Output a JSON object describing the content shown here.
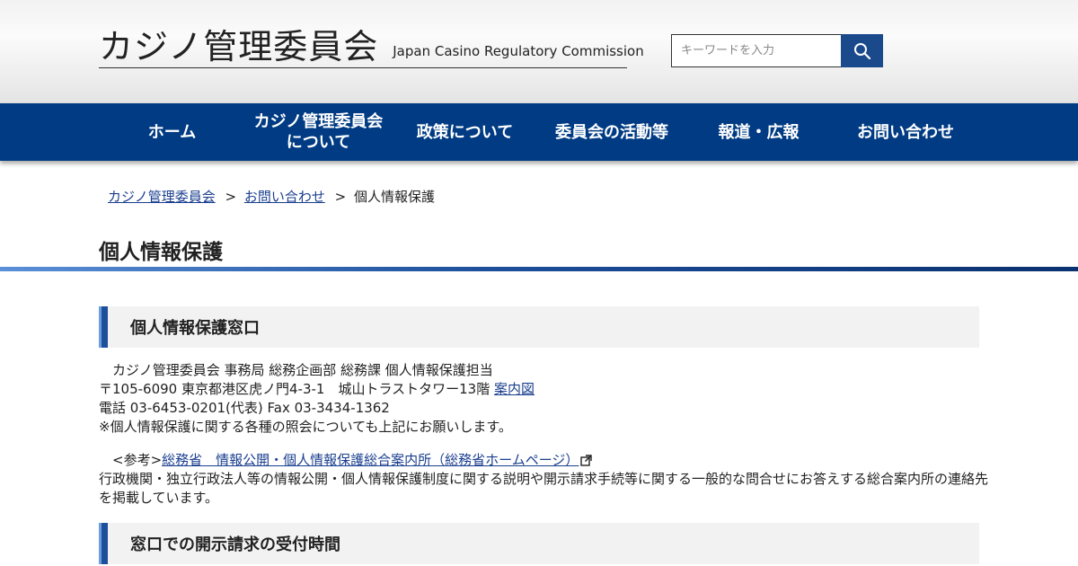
{
  "header": {
    "logo_jp": "カジノ管理委員会",
    "logo_en": "Japan Casino Regulatory Commission",
    "search_placeholder": "キーワードを入力",
    "search_icon": "search-icon"
  },
  "nav": {
    "items": [
      {
        "label": "ホーム"
      },
      {
        "label": "カジノ管理委員会\nについて"
      },
      {
        "label": "政策について"
      },
      {
        "label": "委員会の活動等"
      },
      {
        "label": "報道・広報"
      },
      {
        "label": "お問い合わせ"
      }
    ]
  },
  "breadcrumb": {
    "items": [
      {
        "label": "カジノ管理委員会"
      },
      {
        "label": "お問い合わせ"
      }
    ],
    "separator": ">",
    "current": "個人情報保護"
  },
  "page": {
    "title": "個人情報保護"
  },
  "section1": {
    "heading": "個人情報保護窓口",
    "line1": "　カジノ管理委員会 事務局 総務企画部 総務課 個人情報保護担当",
    "line2": "〒105-6090 東京都港区虎ノ門4-3-1　城山トラストタワー13階 ",
    "map_link": "案内図",
    "line3": "電話 03-6453-0201(代表) Fax 03-3434-1362",
    "line4": "※個人情報保護に関する各種の照会についても上記にお願いします。",
    "ref_prefix": "　<参考>",
    "ref_link": "総務省　情報公開・個人情報保護総合案内所（総務省ホームページ）",
    "ref_icon": "external-link-icon",
    "ref_desc": "行政機関・独立行政法人等の情報公開・個人情報保護制度に関する説明や開示請求手続等に関する一般的な問合せにお答えする総合案内所の連絡先を掲載しています。"
  },
  "section2": {
    "heading": "窓口での開示請求の受付時間"
  },
  "colors": {
    "nav_bg": "#003b83",
    "accent": "#1d4f9b",
    "link": "#1a3f8f"
  }
}
